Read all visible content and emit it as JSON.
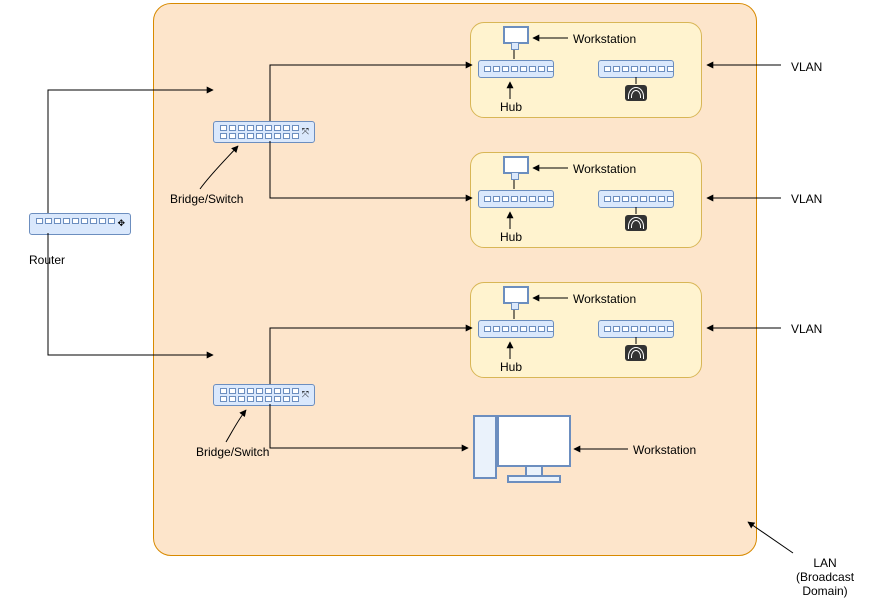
{
  "labels": {
    "router": "Router",
    "bridge_switch_1": "Bridge/Switch",
    "bridge_switch_2": "Bridge/Switch",
    "workstation_1": "Workstation",
    "workstation_2": "Workstation",
    "workstation_3": "Workstation",
    "workstation_4": "Workstation",
    "hub_1": "Hub",
    "hub_2": "Hub",
    "hub_3": "Hub",
    "vlan_1": "VLAN",
    "vlan_2": "VLAN",
    "vlan_3": "VLAN",
    "lan": "LAN\n(Broadcast\nDomain)"
  },
  "diagram": {
    "type": "network-topology",
    "nodes": [
      {
        "id": "router",
        "type": "router",
        "label": "Router"
      },
      {
        "id": "switch1",
        "type": "switch",
        "label": "Bridge/Switch"
      },
      {
        "id": "switch2",
        "type": "switch",
        "label": "Bridge/Switch"
      },
      {
        "id": "vlan1",
        "type": "vlan",
        "label": "VLAN",
        "children": [
          "ws1",
          "hub1",
          "wap1"
        ]
      },
      {
        "id": "vlan2",
        "type": "vlan",
        "label": "VLAN",
        "children": [
          "ws2",
          "hub2",
          "wap2"
        ]
      },
      {
        "id": "vlan3",
        "type": "vlan",
        "label": "VLAN",
        "children": [
          "ws3",
          "hub3",
          "wap3"
        ]
      },
      {
        "id": "ws1",
        "type": "workstation",
        "label": "Workstation"
      },
      {
        "id": "ws2",
        "type": "workstation",
        "label": "Workstation"
      },
      {
        "id": "ws3",
        "type": "workstation",
        "label": "Workstation"
      },
      {
        "id": "ws4",
        "type": "workstation",
        "label": "Workstation"
      },
      {
        "id": "hub1",
        "type": "hub",
        "label": "Hub"
      },
      {
        "id": "hub2",
        "type": "hub",
        "label": "Hub"
      },
      {
        "id": "hub3",
        "type": "hub",
        "label": "Hub"
      },
      {
        "id": "wap1",
        "type": "access-point"
      },
      {
        "id": "wap2",
        "type": "access-point"
      },
      {
        "id": "wap3",
        "type": "access-point"
      },
      {
        "id": "lan",
        "type": "broadcast-domain",
        "label": "LAN (Broadcast Domain)"
      }
    ],
    "edges": [
      {
        "from": "router",
        "to": "switch1"
      },
      {
        "from": "router",
        "to": "switch2"
      },
      {
        "from": "switch1",
        "to": "hub1"
      },
      {
        "from": "switch1",
        "to": "hub2"
      },
      {
        "from": "switch2",
        "to": "hub3"
      },
      {
        "from": "switch2",
        "to": "ws4"
      },
      {
        "from": "hub1",
        "to": "ws1"
      },
      {
        "from": "hub2",
        "to": "ws2"
      },
      {
        "from": "hub3",
        "to": "ws3"
      },
      {
        "from": "hub1",
        "to": "wap1"
      },
      {
        "from": "hub2",
        "to": "wap2"
      },
      {
        "from": "hub3",
        "to": "wap3"
      }
    ]
  }
}
